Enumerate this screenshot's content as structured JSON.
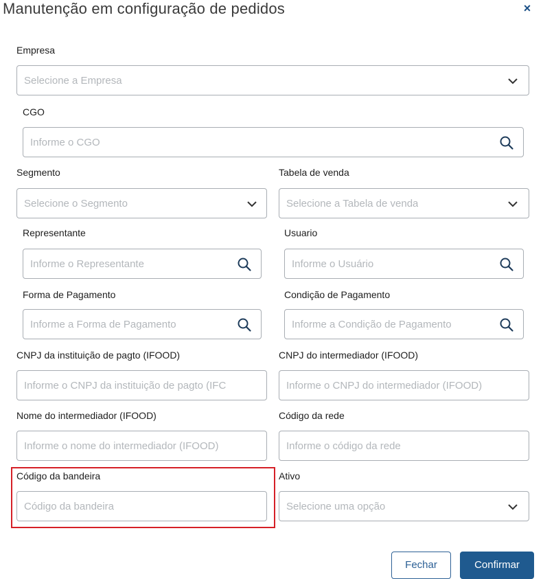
{
  "dialog": {
    "title": "Manutenção em configuração de pedidos",
    "close_label": "×"
  },
  "fields": {
    "empresa": {
      "label": "Empresa",
      "placeholder": "Selecione a Empresa"
    },
    "cgo": {
      "label": "CGO",
      "placeholder": "Informe o CGO"
    },
    "segmento": {
      "label": "Segmento",
      "placeholder": "Selecione o Segmento"
    },
    "tabela_venda": {
      "label": "Tabela de venda",
      "placeholder": "Selecione a Tabela de venda"
    },
    "representante": {
      "label": "Representante",
      "placeholder": "Informe o Representante"
    },
    "usuario": {
      "label": "Usuario",
      "placeholder": "Informe o Usuário"
    },
    "forma_pagamento": {
      "label": "Forma de Pagamento",
      "placeholder": "Informe a Forma de Pagamento"
    },
    "condicao_pagamento": {
      "label": "Condição de Pagamento",
      "placeholder": "Informe a Condição de Pagamento"
    },
    "cnpj_instituicao": {
      "label": "CNPJ da instituição de pagto (IFOOD)",
      "placeholder": "Informe o CNPJ da instituição de pagto (IFC"
    },
    "cnpj_intermediador": {
      "label": "CNPJ do intermediador (IFOOD)",
      "placeholder": "Informe o CNPJ do intermediador (IFOOD)"
    },
    "nome_intermediador": {
      "label": "Nome do intermediador (IFOOD)",
      "placeholder": "Informe o nome do intermediador (IFOOD)"
    },
    "codigo_rede": {
      "label": "Código da rede",
      "placeholder": "Informe o código da rede"
    },
    "codigo_bandeira": {
      "label": "Código da bandeira",
      "placeholder": "Código da bandeira"
    },
    "ativo": {
      "label": "Ativo",
      "placeholder": "Selecione uma opção"
    }
  },
  "buttons": {
    "fechar": "Fechar",
    "confirmar": "Confirmar"
  },
  "colors": {
    "primary": "#1f5a8f",
    "highlight": "#d51f26",
    "border": "#a8adb3",
    "placeholder": "#b3b7bb"
  }
}
